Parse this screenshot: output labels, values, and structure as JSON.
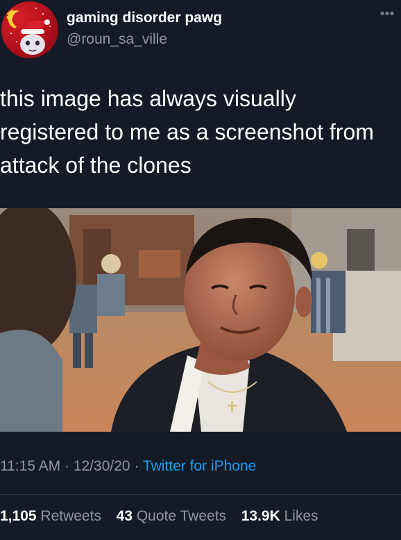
{
  "author": {
    "display_name": "gaming disorder pawg",
    "handle": "@roun_sa_ville",
    "avatar_icon": "hammer-sickle-avatar",
    "more_icon": "more-options-icon"
  },
  "tweet": {
    "text": "this image has always visually registered to me as a screenshot from attack of the clones"
  },
  "meta": {
    "time": "11:15 AM",
    "separator": "·",
    "date": "12/30/20",
    "source": "Twitter for iPhone"
  },
  "stats": {
    "retweets_count": "1,105",
    "retweets_label": "Retweets",
    "quotes_count": "43",
    "quotes_label": "Quote Tweets",
    "likes_count": "13.9K",
    "likes_label": "Likes"
  },
  "colors": {
    "background": "#151b26",
    "secondary_text": "#8b98a5",
    "link": "#1d9bf0"
  }
}
